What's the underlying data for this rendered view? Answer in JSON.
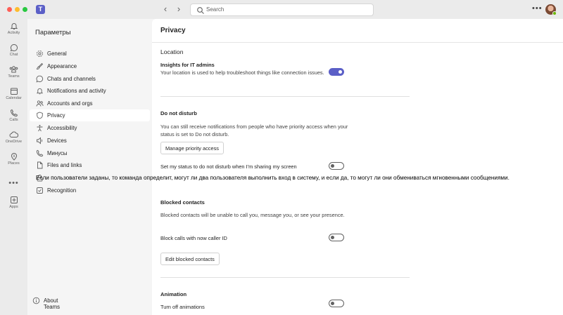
{
  "titlebar": {
    "search_placeholder": "Search",
    "app_icon_letter": "T",
    "more_label": "•••"
  },
  "rail": [
    {
      "label": "Activity",
      "icon": "bell-icon"
    },
    {
      "label": "Chat",
      "icon": "chat-icon"
    },
    {
      "label": "Teams",
      "icon": "teams-icon"
    },
    {
      "label": "Calendar",
      "icon": "calendar-icon"
    },
    {
      "label": "Calls",
      "icon": "phone-icon"
    },
    {
      "label": "OneDrive",
      "icon": "cloud-icon"
    },
    {
      "label": "Places",
      "icon": "location-icon"
    },
    {
      "label": "Apps",
      "icon": "add-app-icon"
    }
  ],
  "rail_more": "•••",
  "sidebar": {
    "title": "Параметры",
    "items": [
      {
        "label": "General",
        "icon": "gear-icon"
      },
      {
        "label": "Appearance",
        "icon": "paintbrush-icon"
      },
      {
        "label": "Chats and channels",
        "icon": "chat-icon"
      },
      {
        "label": "Notifications and activity",
        "icon": "bell-icon"
      },
      {
        "label": "Accounts and orgs",
        "icon": "people-icon"
      },
      {
        "label": "Privacy",
        "icon": "shield-icon",
        "active": true
      },
      {
        "label": "Accessibility",
        "icon": "accessibility-icon"
      },
      {
        "label": "Devices",
        "icon": "speaker-icon"
      },
      {
        "label": "Минусы",
        "icon": "phone-icon"
      },
      {
        "label": "Files and links",
        "icon": "file-icon"
      },
      {
        "label": "",
        "icon": "lock-icon"
      },
      {
        "label": "Recognition",
        "icon": "badge-icon"
      }
    ],
    "about": "About Teams"
  },
  "main": {
    "title": "Privacy",
    "location": {
      "heading": "Location",
      "insights_title": "Insights for IT admins",
      "insights_desc": "Your location is used to help troubleshoot things like connection issues.",
      "insights_on": true
    },
    "dnd": {
      "heading": "Do not disturb",
      "desc": "You can still receive notifications from people who have priority access when your status is set to Do not disturb.",
      "manage_button": "Manage priority access",
      "screen_share_label": "Set my status to do not disturb when I'm sharing my screen",
      "screen_share_on": false
    },
    "blocked": {
      "heading": "Blocked contacts",
      "desc": "Blocked contacts will be unable to call you, message you, or see your presence.",
      "block_calls_label": "Block calls with now caller ID",
      "block_calls_on": false,
      "edit_button": "Edit blocked contacts"
    },
    "animation": {
      "heading": "Animation",
      "turn_off_label": "Turn off animations",
      "turn_off_on": false
    }
  },
  "overlay_text": "Если пользователи заданы, то команда определит, могут ли два пользователя выполнить вход в систему, и если да, то могут ли они обмениваться мгновенными сообщениями.",
  "colors": {
    "accent": "#5b5fc7",
    "chrome": "#ebebeb",
    "panel": "#ffffff"
  }
}
